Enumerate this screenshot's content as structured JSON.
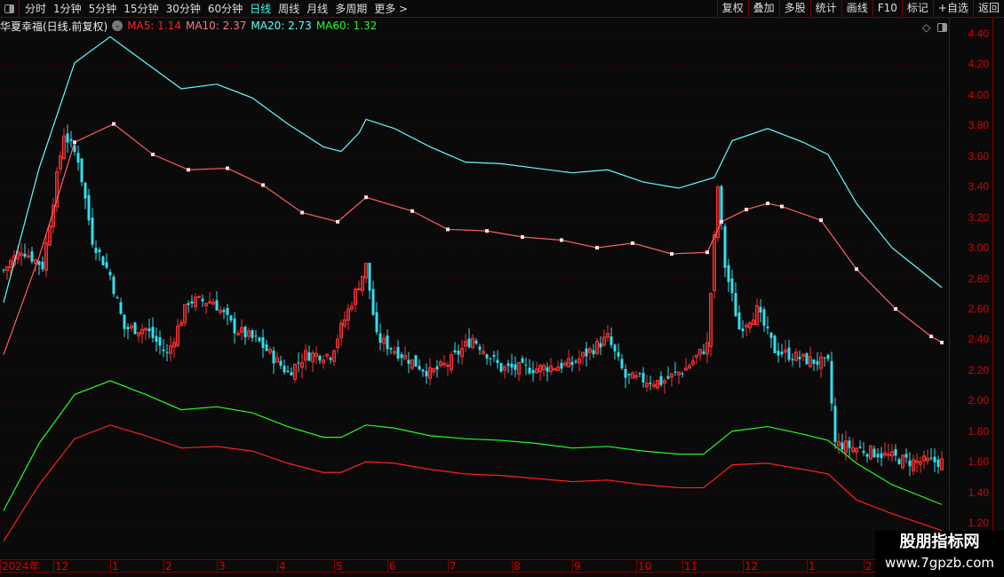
{
  "toolbar": {
    "periods": [
      "分时",
      "1分钟",
      "5分钟",
      "15分钟",
      "30分钟",
      "60分钟",
      "日线",
      "周线",
      "月线",
      "多周期",
      "更多 >"
    ],
    "active": "日线",
    "right_buttons": [
      "复权",
      "叠加",
      "多股",
      "统计",
      "画线",
      "F10",
      "标记",
      "+自选",
      "返回"
    ]
  },
  "info": {
    "title": "华夏幸福(日线.前复权)",
    "ma5": "MA5: 1.14",
    "ma10": "MA10: 2.37",
    "ma20": "MA20: 2.73",
    "ma60": "MA60: 1.32"
  },
  "colors": {
    "ma5": "#ff2020",
    "ma10": "#ff7b7b",
    "ma20": "#60ffff",
    "ma60": "#20ff20",
    "up": "#ff3030",
    "down": "#30e0f0"
  },
  "axis": {
    "ticks": [
      "4.40",
      "4.20",
      "4.00",
      "3.80",
      "3.60",
      "3.40",
      "3.20",
      "3.00",
      "2.80",
      "2.60",
      "2.40",
      "2.20",
      "2.00",
      "1.80",
      "1.60",
      "1.40",
      "1.20"
    ]
  },
  "dates": [
    {
      "label": "2024年",
      "day": 0
    },
    {
      "label": "12",
      "day": 15
    },
    {
      "label": "1",
      "day": 31
    },
    {
      "label": "2",
      "day": 46
    },
    {
      "label": "3",
      "day": 61
    },
    {
      "label": "4",
      "day": 78
    },
    {
      "label": "5",
      "day": 94
    },
    {
      "label": "6",
      "day": 109
    },
    {
      "label": "7",
      "day": 126
    },
    {
      "label": "8",
      "day": 144
    },
    {
      "label": "9",
      "day": 161
    },
    {
      "label": "10",
      "day": 179
    },
    {
      "label": "11",
      "day": 192
    },
    {
      "label": "12",
      "day": 209
    },
    {
      "label": "1",
      "day": 227
    },
    {
      "label": "2",
      "day": 243
    }
  ],
  "watermark": {
    "name": "股朋指标网",
    "url": "www.7gpzb.com"
  },
  "chart_data": {
    "type": "candlestick",
    "price_range": [
      1.08,
      4.48
    ],
    "days": 265,
    "upper_band": [
      [
        0,
        2.64
      ],
      [
        10,
        3.52
      ],
      [
        20,
        4.21
      ],
      [
        30,
        4.38
      ],
      [
        40,
        4.21
      ],
      [
        50,
        4.04
      ],
      [
        60,
        4.07
      ],
      [
        70,
        3.98
      ],
      [
        80,
        3.81
      ],
      [
        90,
        3.66
      ],
      [
        95,
        3.63
      ],
      [
        100,
        3.75
      ],
      [
        102,
        3.84
      ],
      [
        110,
        3.78
      ],
      [
        120,
        3.66
      ],
      [
        130,
        3.56
      ],
      [
        140,
        3.55
      ],
      [
        150,
        3.52
      ],
      [
        160,
        3.49
      ],
      [
        170,
        3.51
      ],
      [
        180,
        3.43
      ],
      [
        190,
        3.39
      ],
      [
        200,
        3.46
      ],
      [
        205,
        3.7
      ],
      [
        215,
        3.78
      ],
      [
        225,
        3.69
      ],
      [
        232,
        3.61
      ],
      [
        240,
        3.29
      ],
      [
        250,
        3.0
      ],
      [
        264,
        2.74
      ]
    ],
    "mid_band": [
      [
        0,
        2.3
      ],
      [
        10,
        2.94
      ],
      [
        20,
        3.69
      ],
      [
        31,
        3.81
      ],
      [
        42,
        3.61
      ],
      [
        52,
        3.51
      ],
      [
        63,
        3.52
      ],
      [
        73,
        3.41
      ],
      [
        84,
        3.23
      ],
      [
        94,
        3.17
      ],
      [
        102,
        3.33
      ],
      [
        115,
        3.24
      ],
      [
        125,
        3.12
      ],
      [
        136,
        3.11
      ],
      [
        146,
        3.07
      ],
      [
        157,
        3.05
      ],
      [
        167,
        3.0
      ],
      [
        177,
        3.03
      ],
      [
        188,
        2.96
      ],
      [
        198,
        2.97
      ],
      [
        202,
        3.17
      ],
      [
        209,
        3.25
      ],
      [
        215,
        3.29
      ],
      [
        219,
        3.27
      ],
      [
        230,
        3.18
      ],
      [
        240,
        2.86
      ],
      [
        251,
        2.6
      ],
      [
        261,
        2.42
      ],
      [
        264,
        2.38
      ]
    ],
    "green_band": [
      [
        0,
        1.28
      ],
      [
        10,
        1.72
      ],
      [
        20,
        2.04
      ],
      [
        30,
        2.13
      ],
      [
        40,
        2.04
      ],
      [
        50,
        1.94
      ],
      [
        60,
        1.96
      ],
      [
        70,
        1.92
      ],
      [
        80,
        1.83
      ],
      [
        90,
        1.76
      ],
      [
        95,
        1.76
      ],
      [
        102,
        1.84
      ],
      [
        110,
        1.82
      ],
      [
        120,
        1.77
      ],
      [
        130,
        1.75
      ],
      [
        140,
        1.74
      ],
      [
        150,
        1.72
      ],
      [
        160,
        1.69
      ],
      [
        170,
        1.7
      ],
      [
        180,
        1.67
      ],
      [
        190,
        1.65
      ],
      [
        197,
        1.65
      ],
      [
        205,
        1.8
      ],
      [
        215,
        1.83
      ],
      [
        225,
        1.78
      ],
      [
        232,
        1.74
      ],
      [
        240,
        1.59
      ],
      [
        250,
        1.45
      ],
      [
        264,
        1.32
      ]
    ],
    "red_band": [
      [
        0,
        1.08
      ],
      [
        10,
        1.45
      ],
      [
        20,
        1.75
      ],
      [
        30,
        1.84
      ],
      [
        40,
        1.77
      ],
      [
        50,
        1.69
      ],
      [
        60,
        1.7
      ],
      [
        70,
        1.67
      ],
      [
        80,
        1.59
      ],
      [
        90,
        1.53
      ],
      [
        95,
        1.53
      ],
      [
        102,
        1.6
      ],
      [
        110,
        1.59
      ],
      [
        120,
        1.55
      ],
      [
        130,
        1.52
      ],
      [
        140,
        1.51
      ],
      [
        150,
        1.49
      ],
      [
        160,
        1.47
      ],
      [
        170,
        1.48
      ],
      [
        180,
        1.45
      ],
      [
        190,
        1.43
      ],
      [
        197,
        1.43
      ],
      [
        205,
        1.58
      ],
      [
        215,
        1.59
      ],
      [
        225,
        1.55
      ],
      [
        232,
        1.52
      ],
      [
        240,
        1.35
      ],
      [
        250,
        1.26
      ],
      [
        264,
        1.15
      ]
    ],
    "close_path": [
      [
        1,
        2.88
      ],
      [
        5,
        2.99
      ],
      [
        11,
        2.88
      ],
      [
        17,
        3.75
      ],
      [
        21,
        3.58
      ],
      [
        25,
        3.05
      ],
      [
        30,
        2.82
      ],
      [
        34,
        2.47
      ],
      [
        40,
        2.47
      ],
      [
        46,
        2.3
      ],
      [
        52,
        2.65
      ],
      [
        59,
        2.65
      ],
      [
        65,
        2.47
      ],
      [
        72,
        2.38
      ],
      [
        80,
        2.18
      ],
      [
        85,
        2.3
      ],
      [
        92,
        2.3
      ],
      [
        97,
        2.59
      ],
      [
        102,
        2.88
      ],
      [
        105,
        2.41
      ],
      [
        112,
        2.3
      ],
      [
        120,
        2.18
      ],
      [
        125,
        2.24
      ],
      [
        132,
        2.41
      ],
      [
        140,
        2.21
      ],
      [
        150,
        2.21
      ],
      [
        160,
        2.24
      ],
      [
        170,
        2.41
      ],
      [
        175,
        2.15
      ],
      [
        185,
        2.12
      ],
      [
        192,
        2.21
      ],
      [
        198,
        2.36
      ],
      [
        201,
        3.4
      ],
      [
        203,
        2.88
      ],
      [
        207,
        2.47
      ],
      [
        212,
        2.59
      ],
      [
        217,
        2.33
      ],
      [
        225,
        2.27
      ],
      [
        232,
        2.24
      ],
      [
        234,
        1.72
      ],
      [
        245,
        1.66
      ],
      [
        255,
        1.6
      ],
      [
        264,
        1.6
      ]
    ]
  }
}
